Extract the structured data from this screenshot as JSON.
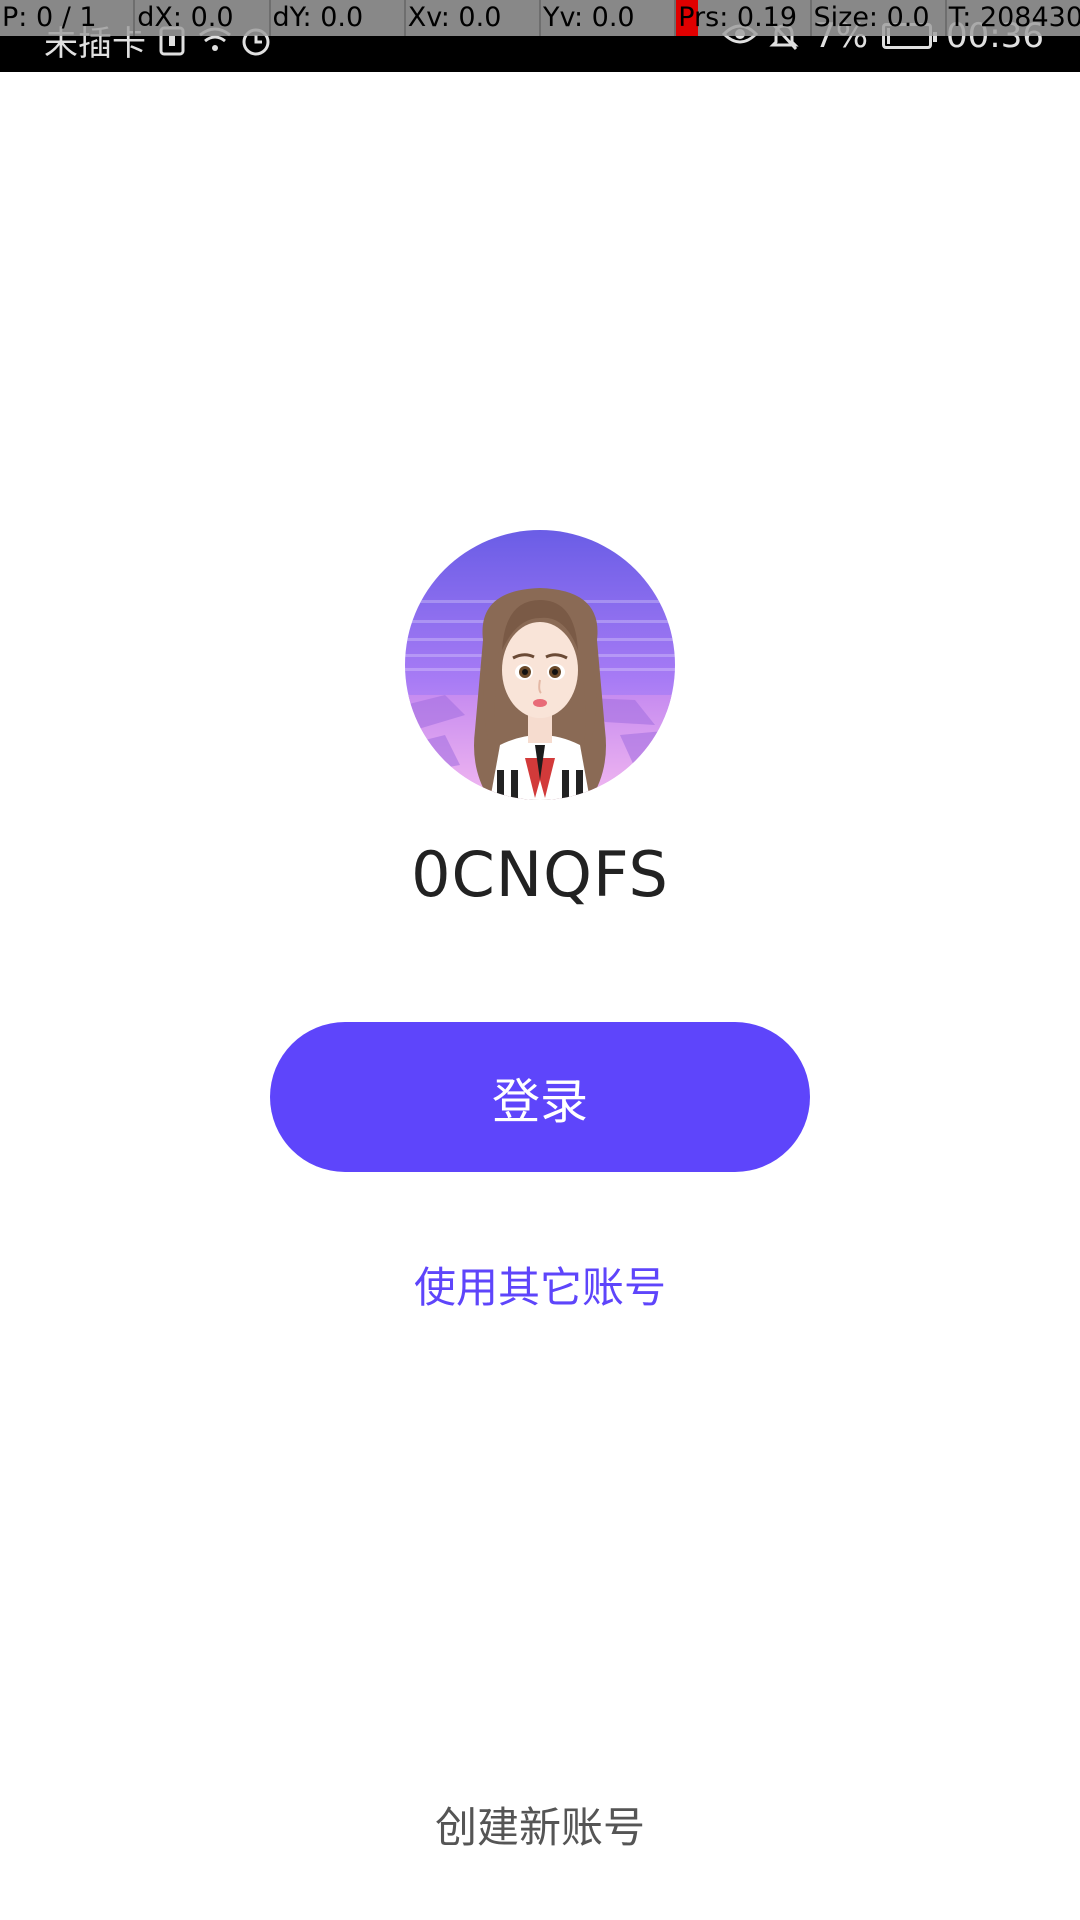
{
  "status_bar": {
    "carrier": "未插卡",
    "battery": "7%",
    "battery_level": 0.07,
    "time": "00:36",
    "icons": [
      "sim-icon",
      "wifi-icon",
      "alarm-icon",
      "eye-icon",
      "mute-icon",
      "battery-icon"
    ]
  },
  "pointer_overlay": {
    "p": "P: 0 / 1",
    "dx": "dX: 0.0",
    "dy": "dY: 0.0",
    "xv": "Xv: 0.0",
    "yv": "Yv: 0.0",
    "prs": "Prs: 0.19",
    "size": "Size: 0.0",
    "t": "T: 208430"
  },
  "profile": {
    "username": "0CNQFS"
  },
  "actions": {
    "login_label": "登录",
    "other_account_label": "使用其它账号",
    "create_account_label": "创建新账号"
  },
  "colors": {
    "accent": "#5e45fb",
    "status_bar_bg": "#000000",
    "page_bg": "#ffffff"
  }
}
